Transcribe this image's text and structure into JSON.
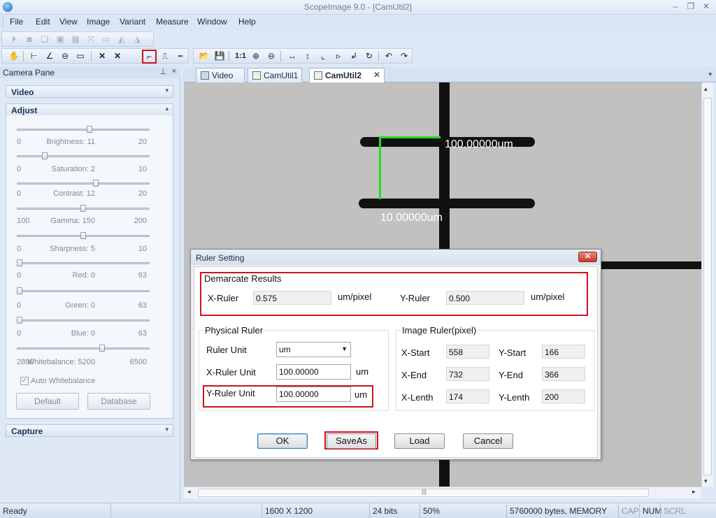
{
  "window": {
    "title": "ScopeImage 9.0 - [CamUtil2]",
    "min_glyph": "–",
    "restore_glyph": "❐",
    "close_glyph": "✕"
  },
  "menu": [
    "File",
    "Edit",
    "View",
    "Image",
    "Variant",
    "Measure",
    "Window",
    "Help"
  ],
  "camera_pane": {
    "title": "Camera Pane",
    "pin_glyph": "⊥",
    "close_glyph": "×",
    "sections": {
      "video": "Video",
      "adjust": "Adjust",
      "capture": "Capture"
    },
    "sliders": [
      {
        "name": "Brightness",
        "label": "Brightness: 11",
        "min": "0",
        "max": "20",
        "value": 11,
        "range": [
          0,
          20
        ]
      },
      {
        "name": "Saturation",
        "label": "Saturation: 2",
        "min": "0",
        "max": "10",
        "value": 2,
        "range": [
          0,
          10
        ]
      },
      {
        "name": "Contrast",
        "label": "Contrast: 12",
        "min": "0",
        "max": "20",
        "value": 12,
        "range": [
          0,
          20
        ]
      },
      {
        "name": "Gamma",
        "label": "Gamma: 150",
        "min": "100",
        "max": "200",
        "value": 150,
        "range": [
          100,
          200
        ]
      },
      {
        "name": "Sharpness",
        "label": "Sharpness: 5",
        "min": "0",
        "max": "10",
        "value": 5,
        "range": [
          0,
          10
        ]
      },
      {
        "name": "Red",
        "label": "Red: 0",
        "min": "0",
        "max": "63",
        "value": 0,
        "range": [
          0,
          63
        ]
      },
      {
        "name": "Green",
        "label": "Green: 0",
        "min": "0",
        "max": "63",
        "value": 0,
        "range": [
          0,
          63
        ]
      },
      {
        "name": "Blue",
        "label": "Blue: 0",
        "min": "0",
        "max": "63",
        "value": 0,
        "range": [
          0,
          63
        ]
      },
      {
        "name": "Whitebalance",
        "label": "Whitebalance: 5200",
        "min": "2800",
        "max": "6500",
        "value": 5200,
        "range": [
          2800,
          6500
        ]
      }
    ],
    "auto_whitebalance": {
      "label": "Auto Whitebalance",
      "checked": true
    },
    "buttons": {
      "default": "Default",
      "database": "Database"
    }
  },
  "tabs": [
    {
      "label": "Video",
      "icon": "video-icon",
      "active": false
    },
    {
      "label": "CamUtil1",
      "icon": "image-doc-icon",
      "active": false
    },
    {
      "label": "CamUtil2",
      "icon": "image-doc-icon",
      "active": true
    }
  ],
  "image_view": {
    "x_ruler_label": "100.00000um",
    "y_ruler_label": "10.00000um",
    "ruler_color": "#22dd22"
  },
  "dialog": {
    "title": "Ruler Setting",
    "demarcate": {
      "title": "Demarcate Results",
      "x_label": "X-Ruler",
      "x_value": "0.575",
      "x_unit": "um/pixel",
      "y_label": "Y-Ruler",
      "y_value": "0.500",
      "y_unit": "um/pixel"
    },
    "physical": {
      "title": "Physical Ruler",
      "unit_label": "Ruler Unit",
      "unit_value": "um",
      "x_label": "X-Ruler Unit",
      "x_value": "100.00000",
      "x_unit": "um",
      "y_label": "Y-Ruler Unit",
      "y_value": "100.00000",
      "y_unit": "um"
    },
    "image_ruler": {
      "title": "Image Ruler(pixel)",
      "x_start_label": "X-Start",
      "x_start": "558",
      "y_start_label": "Y-Start",
      "y_start": "166",
      "x_end_label": "X-End",
      "x_end": "732",
      "y_end_label": "Y-End",
      "y_end": "366",
      "x_len_label": "X-Lenth",
      "x_len": "174",
      "y_len_label": "Y-Lenth",
      "y_len": "200"
    },
    "buttons": {
      "ok": "OK",
      "saveas": "SaveAs",
      "load": "Load",
      "cancel": "Cancel"
    },
    "highlight_color": "#d0131b"
  },
  "status": {
    "ready": "Ready",
    "resolution": "1600 X 1200",
    "bits": "24 bits",
    "zoom": "50%",
    "memory": "5760000 bytes, MEMORY",
    "cap": "CAP",
    "num": "NUM",
    "scrl": "SCRL"
  }
}
